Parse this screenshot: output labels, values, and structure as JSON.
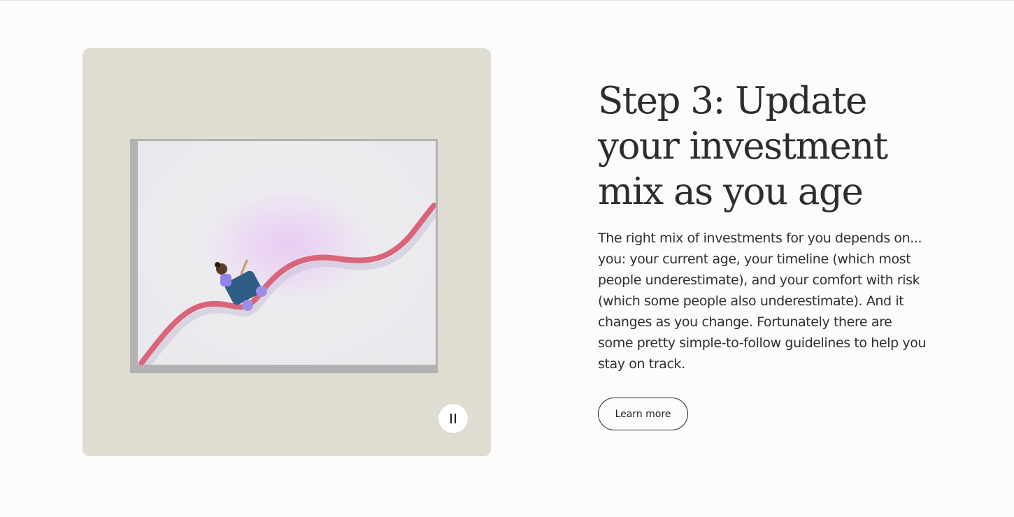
{
  "section": {
    "headline": "Step 3: Update your investment mix as you age",
    "body": "The right mix of investments for you depends on... you: your current age, your timeline (which most people underestimate), and your comfort with risk (which some people also underestimate). And it changes as you change. Fortunately there are some pretty simple-to-follow guidelines to help you stay on track.",
    "cta_label": "Learn more"
  },
  "media": {
    "control": "pause",
    "control_icon": "pause-icon",
    "colors": {
      "card_background": "#dfddd2",
      "track": "#d9657a",
      "cart": "#2f5d86",
      "wheels": "#a08ce8"
    }
  }
}
